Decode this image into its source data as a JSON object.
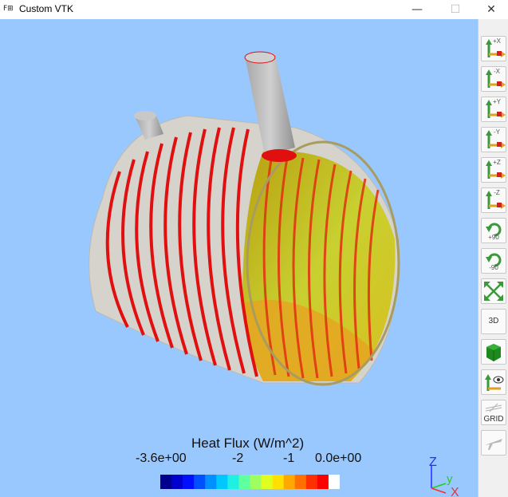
{
  "window": {
    "title": "Custom VTK",
    "app_icon_text": "F⊞",
    "minimize_glyph": "—",
    "maximize_glyph": "☐",
    "close_glyph": "✕"
  },
  "toolbar": {
    "buttons": [
      {
        "label": "+X",
        "icon": "view-plus-x-icon"
      },
      {
        "label": "-X",
        "icon": "view-minus-x-icon"
      },
      {
        "label": "+Y",
        "icon": "view-plus-y-icon"
      },
      {
        "label": "-Y",
        "icon": "view-minus-y-icon"
      },
      {
        "label": "+Z",
        "icon": "view-plus-z-icon"
      },
      {
        "label": "-Z",
        "icon": "view-minus-z-icon"
      },
      {
        "label": "+90",
        "icon": "rotate-cw-icon"
      },
      {
        "label": "-90",
        "icon": "rotate-ccw-icon"
      },
      {
        "label": "",
        "icon": "fit-view-icon"
      },
      {
        "label": "3D",
        "icon": "3d-view-icon"
      },
      {
        "label": "",
        "icon": "green-cube-icon"
      },
      {
        "label": "",
        "icon": "camera-axes-icon"
      },
      {
        "label": "GRID",
        "icon": "grid-icon"
      },
      {
        "label": "",
        "icon": "airplane-icon"
      }
    ]
  },
  "legend": {
    "title": "Heat Flux (W/m^2)",
    "ticks": [
      "-3.6e+00",
      "-2",
      "-1",
      "0.0e+00"
    ],
    "range": [
      -3.6,
      0.0
    ],
    "colors": [
      "#00008f",
      "#0000cf",
      "#0010ff",
      "#0050ff",
      "#0090ff",
      "#00c8ff",
      "#20f0e0",
      "#60ffa0",
      "#a0ff60",
      "#e0ff20",
      "#ffe000",
      "#ffa800",
      "#ff7000",
      "#ff3000",
      "#ff0000",
      "#ffffff"
    ]
  },
  "axes": {
    "x": "X",
    "y": "y",
    "z": "Z",
    "x_color": "#ff2a2a",
    "y_color": "#22cc22",
    "z_color": "#2a2aff"
  },
  "colors": {
    "viewport_bg": "#99c8ff",
    "surface": "#d6d3cc",
    "hot": "#e01010",
    "inner": "#c8b820"
  }
}
